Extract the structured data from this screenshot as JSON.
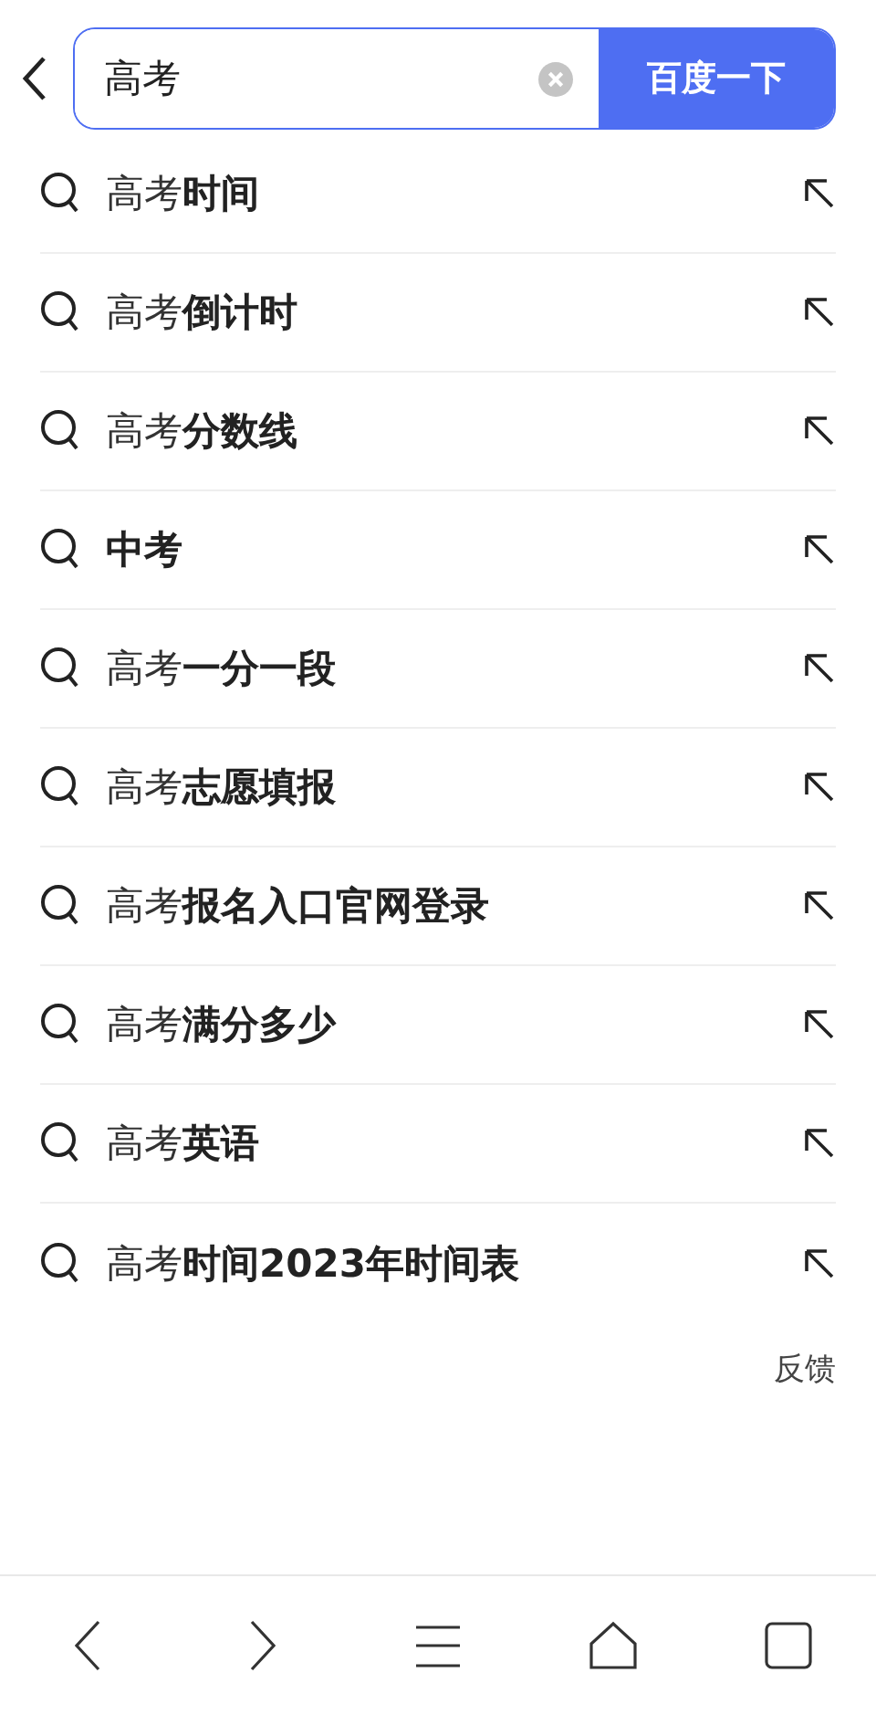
{
  "search": {
    "value": "高考",
    "button": "百度一下"
  },
  "suggestions": [
    {
      "text": "高考**时间**"
    },
    {
      "text": "高考**倒计时**"
    },
    {
      "text": "高考**分数线**"
    },
    {
      "text": "**中考**"
    },
    {
      "text": "高考**一分一段**"
    },
    {
      "text": "高考**志愿填报**"
    },
    {
      "text": "高考**报名入口官网登录**"
    },
    {
      "text": "高考**满分多少**"
    },
    {
      "text": "高考**英语**"
    },
    {
      "text": "高考**时间2023年时间表**"
    }
  ],
  "feedback": "反馈"
}
